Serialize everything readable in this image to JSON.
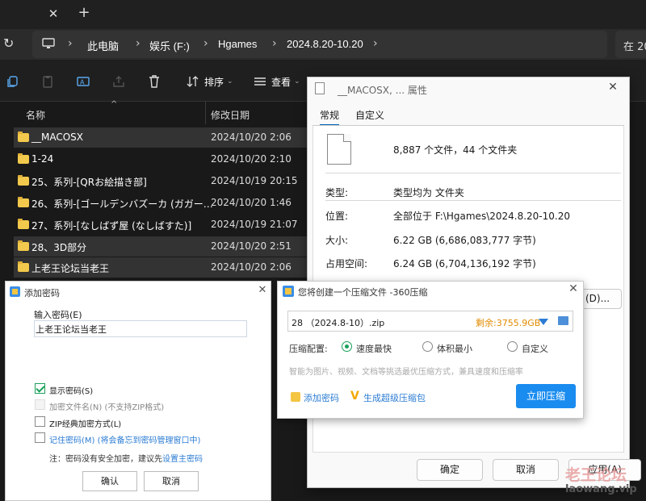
{
  "explorer": {
    "breadcrumbs": [
      "此电脑",
      "娱乐 (F:)",
      "Hgames",
      "2024.8.20-10.20"
    ],
    "search_prefix": "在 20",
    "toolbar": {
      "sort_label": "排序",
      "view_label": "查看"
    },
    "columns": {
      "name": "名称",
      "date": "修改日期"
    },
    "files": [
      {
        "name": "__MACOSX",
        "date": "2024/10/20 2:06",
        "selected": true
      },
      {
        "name": "1-24",
        "date": "2024/10/20 2:10",
        "selected": false
      },
      {
        "name": "25、系列-[QRお絵描き部]",
        "date": "2024/10/19 20:15",
        "selected": false
      },
      {
        "name": "26、系列-[ゴールデンバズーカ (ガガー…",
        "date": "2024/10/20 1:46",
        "selected": false
      },
      {
        "name": "27、系列-[なしばず屋 (なしばすた)]",
        "date": "2024/10/19 21:07",
        "selected": false
      },
      {
        "name": "28、3D部分",
        "date": "2024/10/20 2:51",
        "selected": true
      },
      {
        "name": "上老王论坛当老王",
        "date": "2024/10/20 2:06",
        "selected": true
      }
    ]
  },
  "properties": {
    "title": "__MACOSX, ... 属性",
    "tabs": [
      "常规",
      "自定义"
    ],
    "summary": "8,887 个文件，44 个文件夹",
    "rows": [
      {
        "label": "类型:",
        "value": "类型均为 文件夹"
      },
      {
        "label": "位置:",
        "value": "全部位于 F:\\Hgames\\2024.8.20-10.20"
      },
      {
        "label": "大小:",
        "value": "6.22 GB (6,686,083,777 字节)"
      },
      {
        "label": "占用空间:",
        "value": "6.24 GB (6,704,136,192 字节)"
      }
    ],
    "hidden_button": "(D)...",
    "buttons": {
      "ok": "确定",
      "cancel": "取消",
      "apply": "应用(A)"
    }
  },
  "compress": {
    "title": "您将创建一个压缩文件 -360压缩",
    "filename": "28 （2024.8-10）.zip",
    "free_space": "剩余:3755.9GB",
    "config_label": "压缩配置:",
    "options": [
      "速度最快",
      "体积最小",
      "自定义"
    ],
    "selected_option": "速度最快",
    "hint": "智能为图片、视频、文档等挑选最优压缩方式，兼具速度和压缩率",
    "add_password": "添加密码",
    "super_pack": "生成超级压缩包",
    "start_button": "立即压缩"
  },
  "add_password": {
    "title": "添加密码",
    "input_label": "输入密码(E)",
    "password_value": "上老王论坛当老王",
    "checkboxes": [
      {
        "label": "显示密码(S)",
        "checked": true,
        "disabled": false
      },
      {
        "label": "加密文件名(N) (不支持ZIP格式)",
        "checked": false,
        "disabled": true
      },
      {
        "label": "ZIP经典加密方式(L)",
        "checked": false,
        "disabled": false
      },
      {
        "label": "记住密码(M) (将会备忘到密码管理窗口中)",
        "checked": false,
        "disabled": false
      }
    ],
    "note_prefix": "注：密码没有安全加密，建议先",
    "note_link": "设置主密码",
    "ok": "确认",
    "cancel": "取消"
  },
  "watermark": {
    "line1": "老王论坛",
    "line2": "laowang.vip"
  },
  "colors": {
    "accent": "#1a8cf0",
    "selected_radio": "#1aa05a",
    "link": "#2b7cd3",
    "free_space": "#e08a00"
  }
}
